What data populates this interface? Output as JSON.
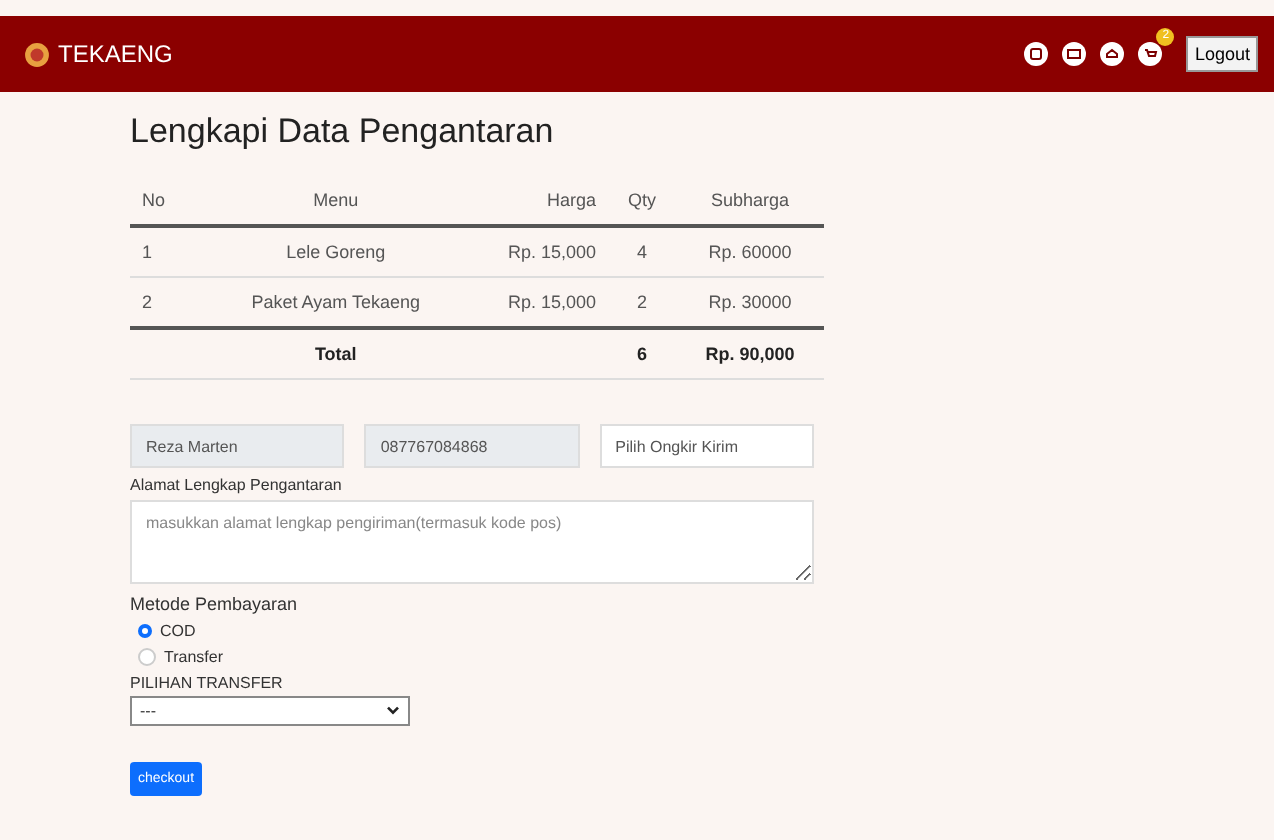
{
  "navbar": {
    "brand": "TEKAENG",
    "cart_count": "2",
    "logout": "Logout"
  },
  "title": "Lengkapi Data Pengantaran",
  "table": {
    "columns": [
      "No",
      "Menu",
      "Harga",
      "Qty",
      "Subharga"
    ],
    "rows": [
      [
        "1",
        "Lele Goreng",
        "Rp. 15,000",
        "4",
        "Rp. 60000"
      ],
      [
        "2",
        "Paket Ayam Tekaeng",
        "Rp. 15,000",
        "2",
        "Rp. 30000"
      ]
    ],
    "total": {
      "label": "Total",
      "qty": "6",
      "amount": "Rp. 90,000"
    }
  },
  "form": {
    "name": "Reza Marten",
    "phone": "087767084868",
    "ongkir_placeholder": "Pilih Ongkir Kirim",
    "address_label": "Alamat Lengkap Pengantaran",
    "address_placeholder": "masukkan alamat lengkap pengiriman(termasuk kode pos)",
    "payment_label": "Metode Pembayaran",
    "payment_options": [
      {
        "label": "COD",
        "selected": true
      },
      {
        "label": "Transfer",
        "selected": false
      }
    ],
    "transfer_label": "PILIHAN TRANSFER",
    "transfer_value": "---",
    "submit": "checkout"
  }
}
